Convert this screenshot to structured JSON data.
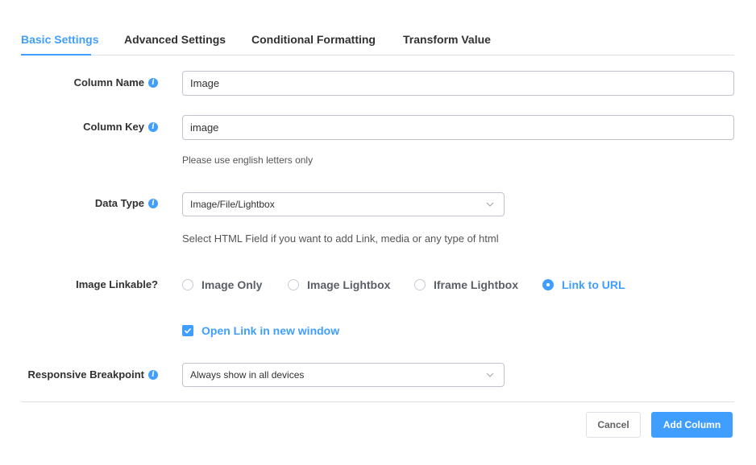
{
  "tabs": [
    {
      "label": "Basic Settings",
      "active": true
    },
    {
      "label": "Advanced Settings",
      "active": false
    },
    {
      "label": "Conditional Formatting",
      "active": false
    },
    {
      "label": "Transform Value",
      "active": false
    }
  ],
  "column_name": {
    "label": "Column Name",
    "value": "Image"
  },
  "column_key": {
    "label": "Column Key",
    "value": "image",
    "help": "Please use english letters only"
  },
  "data_type": {
    "label": "Data Type",
    "selected": "Image/File/Lightbox",
    "help": "Select HTML Field if you want to add Link, media or any type of html"
  },
  "image_linkable": {
    "label": "Image Linkable?",
    "options": [
      "Image Only",
      "Image Lightbox",
      "Iframe Lightbox",
      "Link to URL"
    ],
    "selected": "Link to URL"
  },
  "open_link": {
    "label": "Open Link in new window",
    "checked": true
  },
  "responsive": {
    "label": "Responsive Breakpoint",
    "selected": "Always show in all devices"
  },
  "footer": {
    "cancel_label": "Cancel",
    "add_label": "Add Column"
  },
  "colors": {
    "accent": "#409eff",
    "text": "#303133",
    "border": "#dcdfe6"
  },
  "icons": {
    "info": "info-icon",
    "dropdown": "chevron-down-icon",
    "check": "check-icon"
  }
}
